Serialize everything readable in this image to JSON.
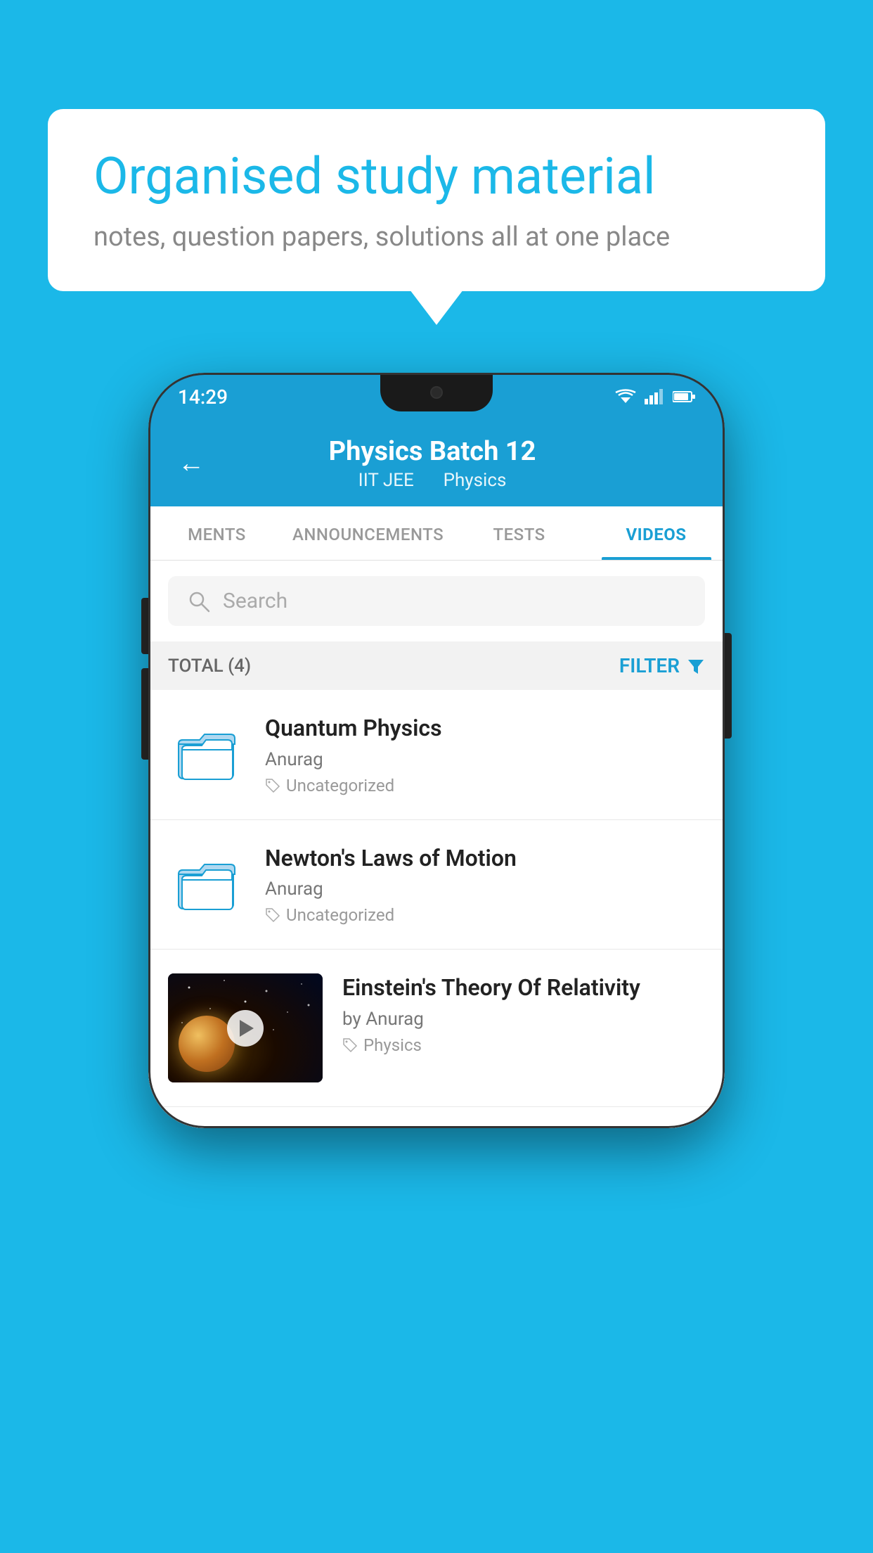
{
  "background_color": "#1bb8e8",
  "speech_bubble": {
    "title": "Organised study material",
    "subtitle": "notes, question papers, solutions all at one place"
  },
  "phone": {
    "status_bar": {
      "time": "14:29",
      "wifi": "▾",
      "signal": "▴",
      "battery": "▮"
    },
    "header": {
      "back_label": "←",
      "title": "Physics Batch 12",
      "subtitle_part1": "IIT JEE",
      "subtitle_part2": "Physics"
    },
    "tabs": [
      {
        "label": "MENTS",
        "active": false
      },
      {
        "label": "ANNOUNCEMENTS",
        "active": false
      },
      {
        "label": "TESTS",
        "active": false
      },
      {
        "label": "VIDEOS",
        "active": true
      }
    ],
    "search": {
      "placeholder": "Search"
    },
    "filter": {
      "total_label": "TOTAL (4)",
      "filter_label": "FILTER"
    },
    "videos": [
      {
        "id": "v1",
        "title": "Quantum Physics",
        "author": "Anurag",
        "tag": "Uncategorized",
        "type": "folder"
      },
      {
        "id": "v2",
        "title": "Newton's Laws of Motion",
        "author": "Anurag",
        "tag": "Uncategorized",
        "type": "folder"
      },
      {
        "id": "v3",
        "title": "Einstein's Theory Of Relativity",
        "author": "by Anurag",
        "tag": "Physics",
        "type": "video"
      }
    ]
  }
}
